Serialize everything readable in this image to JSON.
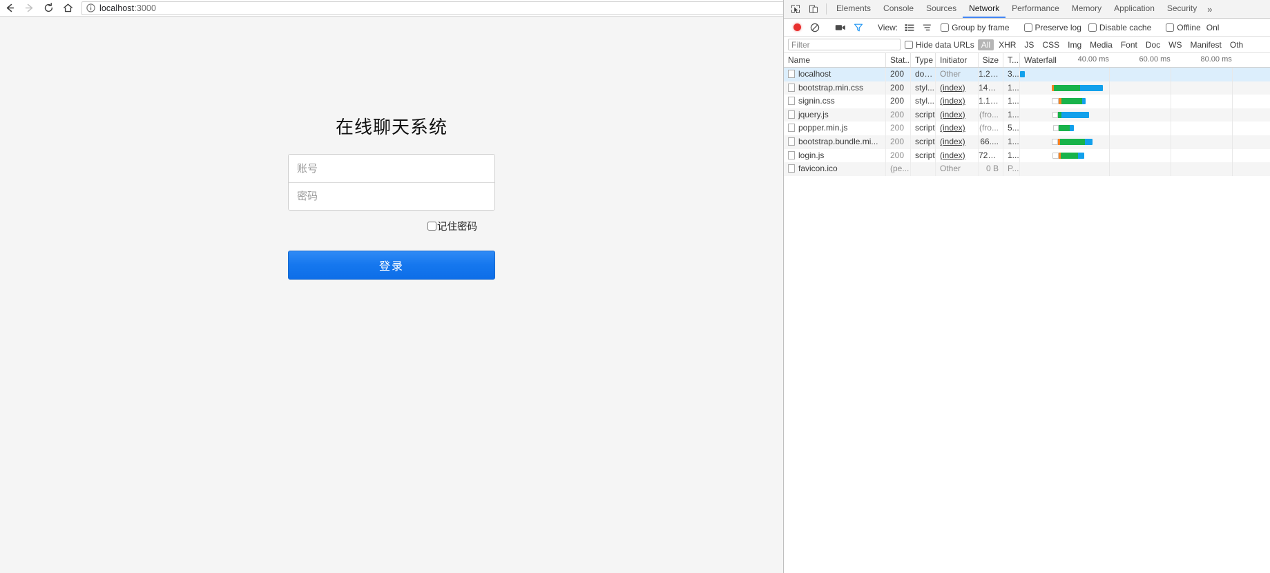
{
  "browser": {
    "back_label": "back-arrow",
    "forward_label": "forward-arrow",
    "reload_label": "reload",
    "home_label": "home",
    "url_host": "localhost",
    "url_port": ":3000",
    "url_full": "localhost:3000",
    "info_icon": "info-circle-icon",
    "bookmark_icon": "star-icon"
  },
  "page": {
    "title": "在线聊天系统",
    "account_placeholder": "账号",
    "account_value": "",
    "password_placeholder": "密码",
    "password_value": "",
    "remember_label": "记住密码",
    "remember_checked": false,
    "login_button": "登录",
    "button_color": "#1577ee",
    "background_color": "#f5f5f5"
  },
  "devtools": {
    "icons": {
      "inspect": "inspect-element-icon",
      "device": "device-toolbar-icon",
      "record": "record-icon",
      "clear": "clear-icon",
      "capture": "capture-screenshots-icon",
      "filter": "filter-icon",
      "view_list": "view-list-icon",
      "view_waterfall": "view-waterfall-icon",
      "more": "»"
    },
    "tabs": [
      {
        "label": "Elements",
        "active": false
      },
      {
        "label": "Console",
        "active": false
      },
      {
        "label": "Sources",
        "active": false
      },
      {
        "label": "Network",
        "active": true
      },
      {
        "label": "Performance",
        "active": false
      },
      {
        "label": "Memory",
        "active": false
      },
      {
        "label": "Application",
        "active": false
      },
      {
        "label": "Security",
        "active": false
      }
    ],
    "toolbar": {
      "view_label": "View:",
      "group_by_frame": "Group by frame",
      "preserve_log": "Preserve log",
      "disable_cache": "Disable cache",
      "offline": "Offline",
      "online": "Onl"
    },
    "filterbar": {
      "filter_placeholder": "Filter",
      "filter_value": "",
      "hide_data_urls": "Hide data URLs",
      "types": [
        {
          "label": "All",
          "active": true
        },
        {
          "label": "XHR",
          "active": false
        },
        {
          "label": "JS",
          "active": false
        },
        {
          "label": "CSS",
          "active": false
        },
        {
          "label": "Img",
          "active": false
        },
        {
          "label": "Media",
          "active": false
        },
        {
          "label": "Font",
          "active": false
        },
        {
          "label": "Doc",
          "active": false
        },
        {
          "label": "WS",
          "active": false
        },
        {
          "label": "Manifest",
          "active": false
        },
        {
          "label": "Oth",
          "active": false
        }
      ]
    },
    "table": {
      "headers": {
        "name": "Name",
        "status": "Stat...",
        "type": "Type",
        "initiator": "Initiator",
        "size": "Size",
        "time": "T...",
        "waterfall": "Waterfall"
      },
      "waterfall_ticks": [
        "40.00 ms",
        "60.00 ms",
        "80.00 ms"
      ],
      "rows": [
        {
          "name": "localhost",
          "status": "200",
          "type": "doc...",
          "initiator": "Other",
          "initiator_link": false,
          "size": "1.2 ...",
          "time": "3...",
          "selected": true,
          "bar": {
            "start": 0,
            "stall": 0,
            "wait": 0,
            "dl": 0,
            "blue": 7
          }
        },
        {
          "name": "bootstrap.min.css",
          "status": "200",
          "type": "styl...",
          "initiator": "(index)",
          "initiator_link": true,
          "size": "142...",
          "time": "1...",
          "selected": false,
          "bar": {
            "start": 46,
            "stall": 3,
            "wait": 0,
            "dl": 38,
            "blue": 33
          }
        },
        {
          "name": "signin.css",
          "status": "200",
          "type": "styl...",
          "initiator": "(index)",
          "initiator_link": true,
          "size": "1.1 ...",
          "time": "1...",
          "selected": false,
          "bar": {
            "start": 46,
            "stall": 4,
            "wait": 10,
            "dl": 30,
            "blue": 5
          }
        },
        {
          "name": "jquery.js",
          "status": "200",
          "type": "script",
          "initiator": "(index)",
          "initiator_link": true,
          "size": "(fro...",
          "time": "1...",
          "selected": false,
          "bar": {
            "start": 47,
            "stall": 0,
            "wait": 8,
            "dl": 5,
            "blue": 40
          }
        },
        {
          "name": "popper.min.js",
          "status": "200",
          "type": "script",
          "initiator": "(index)",
          "initiator_link": true,
          "size": "(fro...",
          "time": "5...",
          "selected": false,
          "bar": {
            "start": 48,
            "stall": 0,
            "wait": 8,
            "dl": 16,
            "blue": 6
          }
        },
        {
          "name": "bootstrap.bundle.mi...",
          "status": "200",
          "type": "script",
          "initiator": "(index)",
          "initiator_link": true,
          "size": "66....",
          "time": "1...",
          "selected": false,
          "bar": {
            "start": 46,
            "stall": 3,
            "wait": 9,
            "dl": 36,
            "blue": 11
          }
        },
        {
          "name": "login.js",
          "status": "200",
          "type": "script",
          "initiator": "(index)",
          "initiator_link": true,
          "size": "727...",
          "time": "1...",
          "selected": false,
          "bar": {
            "start": 47,
            "stall": 3,
            "wait": 9,
            "dl": 25,
            "blue": 9
          }
        },
        {
          "name": "favicon.ico",
          "status": "(pe...",
          "type": "",
          "initiator": "Other",
          "initiator_link": false,
          "size": "0 B",
          "time": "P...",
          "selected": false,
          "bar": null
        }
      ]
    }
  }
}
